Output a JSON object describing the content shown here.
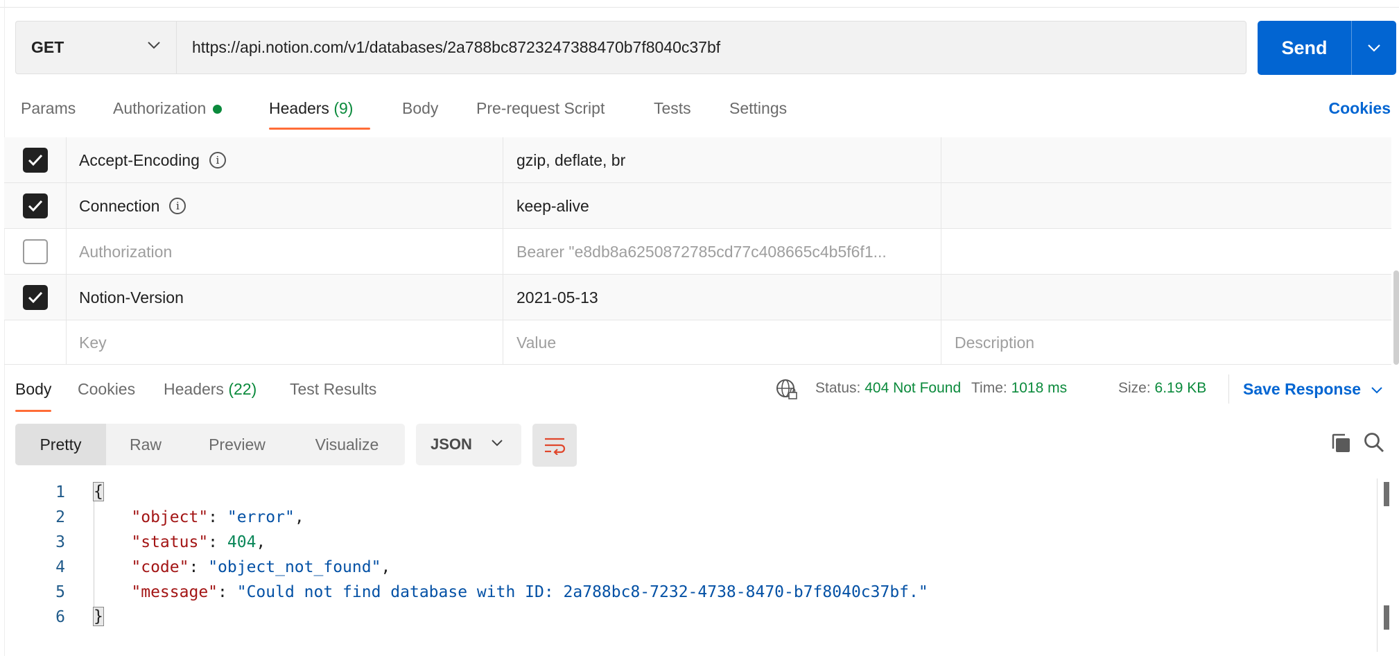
{
  "request": {
    "method": "GET",
    "url": "https://api.notion.com/v1/databases/2a788bc8723247388470b7f8040c37bf",
    "send_label": "Send"
  },
  "request_tabs": {
    "params": "Params",
    "authorization": "Authorization",
    "headers": "Headers",
    "headers_count": "(9)",
    "body": "Body",
    "prerequest": "Pre-request Script",
    "tests": "Tests",
    "settings": "Settings",
    "cookies": "Cookies"
  },
  "header_rows": [
    {
      "checked": true,
      "key": "Accept-Encoding",
      "value": "gzip, deflate, br",
      "description": ""
    },
    {
      "checked": true,
      "key": "Connection",
      "value": "keep-alive",
      "description": ""
    },
    {
      "checked": false,
      "key": "Authorization",
      "value": "Bearer \"e8db8a6250872785cd77c408665c4b5f6f1...",
      "description": ""
    },
    {
      "checked": true,
      "key": "Notion-Version",
      "value": "2021-05-13",
      "description": ""
    }
  ],
  "header_placeholders": {
    "key": "Key",
    "value": "Value",
    "description": "Description"
  },
  "response_tabs": {
    "body": "Body",
    "cookies": "Cookies",
    "headers": "Headers",
    "headers_count": "(22)",
    "test_results": "Test Results"
  },
  "response_status": {
    "status_label": "Status:",
    "status_value": "404 Not Found",
    "time_label": "Time:",
    "time_value": "1018 ms",
    "size_label": "Size:",
    "size_value": "6.19 KB",
    "save_response": "Save Response"
  },
  "view_modes": {
    "pretty": "Pretty",
    "raw": "Raw",
    "preview": "Preview",
    "visualize": "Visualize"
  },
  "format": "JSON",
  "code": {
    "line_numbers": [
      "1",
      "2",
      "3",
      "4",
      "5",
      "6"
    ],
    "open_brace": "{",
    "close_brace": "}",
    "k_object": "\"object\"",
    "v_object": "\"error\"",
    "k_status": "\"status\"",
    "v_status": "404",
    "k_code": "\"code\"",
    "v_code": "\"object_not_found\"",
    "k_message": "\"message\"",
    "v_message": "\"Could not find database with ID: 2a788bc8-7232-4738-8470-b7f8040c37bf.\""
  },
  "colors": {
    "accent_tab": "#ff6c37",
    "send_button": "#0265d2",
    "status_green": "#0b8a3c",
    "json_key": "#a31515",
    "json_string": "#0451a5",
    "json_number": "#098658"
  }
}
